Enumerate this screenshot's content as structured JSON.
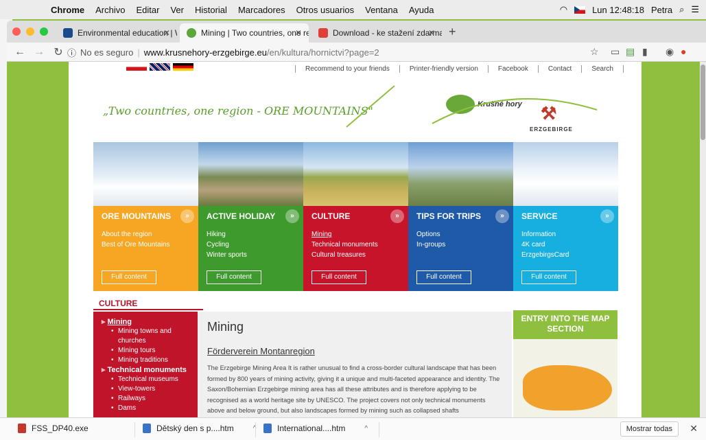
{
  "menubar": {
    "app": "Chrome",
    "items": [
      "Archivo",
      "Editar",
      "Ver",
      "Historial",
      "Marcadores",
      "Otros usuarios",
      "Ventana",
      "Ayuda"
    ],
    "clock": "Lun 12:48:18",
    "user": "Petra"
  },
  "tabs": [
    {
      "title": "Environmental education | Wad",
      "color": "#1a4a8c"
    },
    {
      "title": "Mining | Two countries, one re",
      "color": "#5aa83a"
    },
    {
      "title": "Download - ke stažení zdarma",
      "color": "#e0403a"
    }
  ],
  "address": {
    "security": "No es seguro",
    "host": "www.krusnehory-erzgebirge.eu",
    "path": "/en/kultura/hornictvi?page=2"
  },
  "site": {
    "toplinks": [
      "Recommend to your friends",
      "Printer-friendly version",
      "Facebook",
      "Contact",
      "Search"
    ],
    "slogan": "„Two countries, one region - ORE MOUNTAINS\"",
    "logo_kh": "Krušné hory",
    "logo_erz": "ERZGEBIRGE",
    "nav": [
      {
        "title": "ORE MOUNTAINS",
        "color": "#f6a623",
        "band": "#f6a623",
        "links": [
          "About the region",
          "Best of Ore Mountains"
        ],
        "btn": "Full content"
      },
      {
        "title": "ACTIVE HOLIDAY",
        "color": "#3f9a2e",
        "band": "#3f9a2e",
        "links": [
          "Hiking",
          "Cycling",
          "Winter sports"
        ],
        "btn": "Full content"
      },
      {
        "title": "CULTURE",
        "color": "#c8142a",
        "band": "#c8142a",
        "links": [
          "Mining",
          "Technical monuments",
          "Cultural treasures"
        ],
        "btn": "Full content"
      },
      {
        "title": "TIPS FOR TRIPS",
        "color": "#1f5aa8",
        "band": "#1f5aa8",
        "links": [
          "Options",
          "In-groups"
        ],
        "btn": "Full content"
      },
      {
        "title": "SERVICE",
        "color": "#17aee0",
        "band": "#17aee0",
        "links": [
          "Information",
          "4K card",
          "ErzgebirgsCard"
        ],
        "btn": "Full content"
      }
    ],
    "section_label": "CULTURE",
    "sidebar": [
      {
        "t": "Mining",
        "kind": "sec"
      },
      {
        "t": "Mining towns and",
        "kind": "sub"
      },
      {
        "t": "churches",
        "kind": "cont"
      },
      {
        "t": "Mining tours",
        "kind": "sub"
      },
      {
        "t": "Mining traditions",
        "kind": "sub"
      },
      {
        "t": "Technical monuments",
        "kind": "secp"
      },
      {
        "t": "Technical museums",
        "kind": "sub"
      },
      {
        "t": "View-towers",
        "kind": "sub"
      },
      {
        "t": "Railways",
        "kind": "sub"
      },
      {
        "t": "Dams",
        "kind": "sub"
      }
    ],
    "content": {
      "title": "Mining",
      "subtitle": "Förderverein Montanregion",
      "text": "The Erzgebirge Mining Area It is rather unusual to find a cross-border cultural landscape that has been formed by 800 years of mining activity, giving it a unique and multi-faceted appearance and identity. The Saxon/Bohemian Erzgebirge mining area has all these attributes and is therefore applying to be recognised as a world heritage site by UNESCO. The project covers not only technical monuments above and below ground, but also landscapes formed by mining such as collapsed shafts"
    },
    "rbox_title": "ENTRY INTO THE MAP SECTION"
  },
  "downloads": {
    "items": [
      "FSS_DP40.exe",
      "Dětský den s p....htm",
      "International....htm"
    ],
    "show_all": "Mostrar todas"
  }
}
